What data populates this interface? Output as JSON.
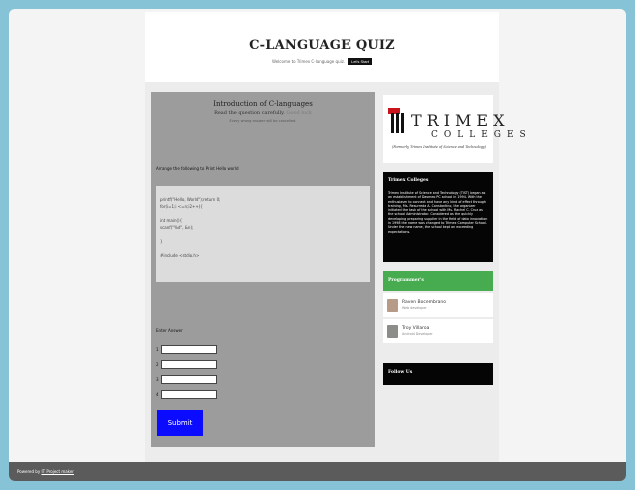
{
  "header": {
    "title": "C-LANGUAGE QUIZ",
    "welcome": "Welcome to Trimex C-language quiz.",
    "start_button": "Let's Start"
  },
  "quiz": {
    "title": "Introduction of C-languages",
    "instruction": "Read the question carefully.",
    "instruction_link": "Good luck",
    "note": "Every wrong answer will be cancelled.",
    "question": "Arrange the following to Print Hello world",
    "code_lines": [
      "printf(\"Hello, World\");return 0;",
      "for(i=1;i <=n;i2++){",
      "",
      "int main(){",
      "scanf(\"%d\", &n);",
      "",
      "}",
      "",
      "#include <stdio.h>"
    ],
    "answer_label": "Enter Answer",
    "answer_numbers": [
      "1",
      "2",
      "3",
      "4"
    ],
    "submit_label": "Submit"
  },
  "sidebar": {
    "logo": {
      "line1": "TRIMEX",
      "line2": "COLLEGES",
      "line3": "(Formerly Trimex Institute of Science and Technology)"
    },
    "about": {
      "title": "Trimex Colleges",
      "text": "Trimex Institute of Science and Technology (TIST) began as an establishment of Dasmeo PC school in 1994. With the enthusiasm to connect and have any kind of effect through training, Ms. Resurreda A. Constantino, the organizer initiated the task of the school with Ms. Rachel C. Cruz as the school Administrator. Considered as the quickly developing preparing supplier in the field of data innovation in 1998 the name was changed to Trimex Computer School. Under the new name, the school kept on exceeding expectations."
    },
    "programmers": {
      "title": "Programmer's",
      "people": [
        {
          "name": "Raven Bocembrano",
          "role": "Web developer"
        },
        {
          "name": "Troy Villaroa",
          "role": "Android Developer"
        }
      ]
    },
    "follow": {
      "title": "Follow Us"
    }
  },
  "footer": {
    "prefix": "Powered by",
    "link": "IT Project maker"
  },
  "colors": {
    "frame_border": "#87c3d6",
    "quiz_panel": "#9c9c9c",
    "submit_button": "#0a0bff",
    "programmers_header": "#47ac4f",
    "logo_red": "#c9141c",
    "footer": "#5b5b5b"
  }
}
